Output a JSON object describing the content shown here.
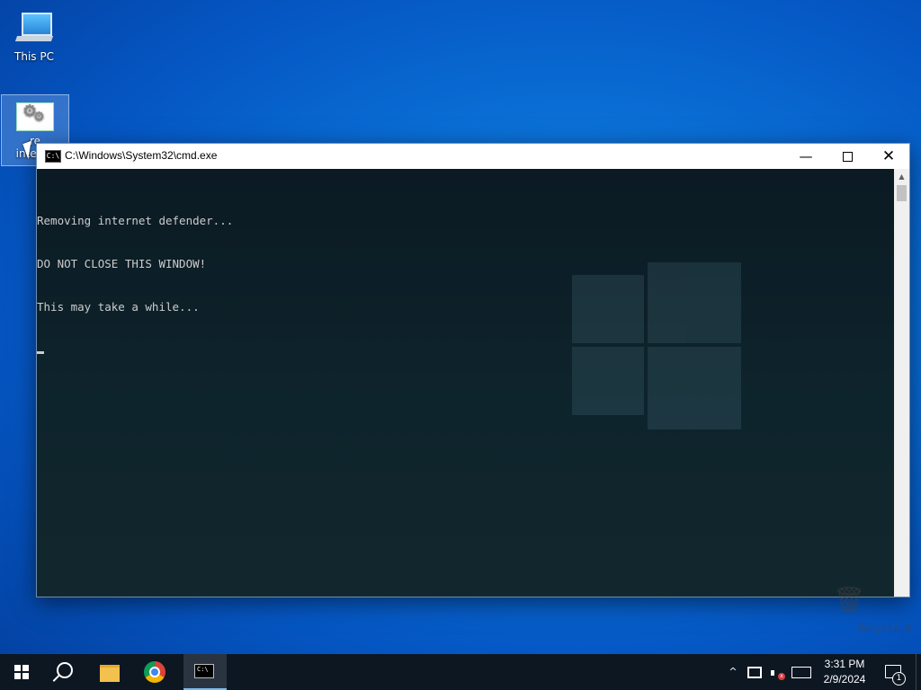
{
  "desktop": {
    "icons": [
      {
        "label": "This PC"
      },
      {
        "label": "re\ninterne"
      }
    ],
    "recycle_bin_label": "Recycle B"
  },
  "cmd_window": {
    "title": "C:\\Windows\\System32\\cmd.exe",
    "icon_text": "C:\\",
    "console_lines": [
      "Removing internet defender...",
      "DO NOT CLOSE THIS WINDOW!",
      "This may take a while..."
    ],
    "buttons": {
      "minimize": "—",
      "close": "✕"
    }
  },
  "taskbar": {
    "items": [
      "start-icon",
      "search-icon",
      "file-explorer-icon",
      "chrome-icon",
      "cmd-icon"
    ],
    "tray": {
      "chevron": "^",
      "time": "3:31 PM",
      "date": "2/9/2024",
      "notification_count": "1"
    }
  },
  "colors": {
    "taskbar_bg": "#0d1722",
    "console_text": "#cccccc",
    "active_underline": "#76b9ed"
  }
}
